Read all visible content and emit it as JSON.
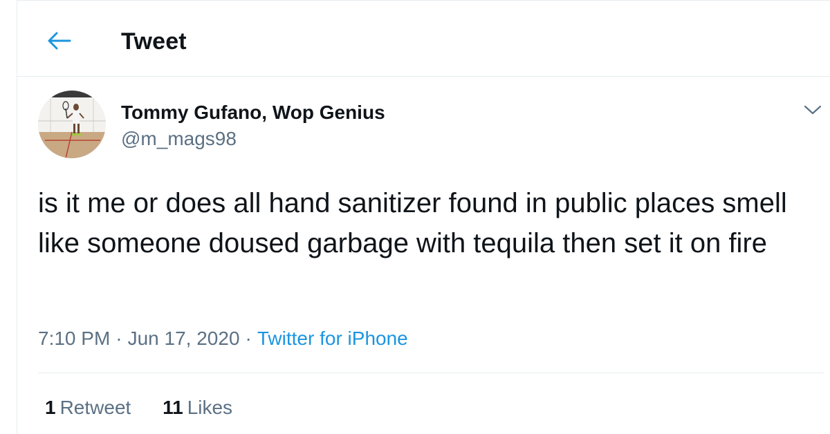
{
  "header": {
    "title": "Tweet",
    "back_icon": "arrow-left-icon"
  },
  "author": {
    "name": "Tommy Gufano, Wop Genius",
    "handle": "@m_mags98",
    "avatar_icon": "profile-photo"
  },
  "tweet": {
    "text": "is it me or does all hand sanitizer found in public places smell like someone doused garbage with tequila then set it on fire",
    "time": "7:10 PM",
    "date": "Jun 17, 2020",
    "source": "Twitter for iPhone",
    "separator": "·"
  },
  "stats": {
    "retweets_count": "1",
    "retweets_label": "Retweet",
    "likes_count": "11",
    "likes_label": "Likes"
  },
  "colors": {
    "accent": "#1b95e0",
    "secondary_text": "#5b7083",
    "primary_text": "#0f1419",
    "border": "#e6ecf0"
  }
}
